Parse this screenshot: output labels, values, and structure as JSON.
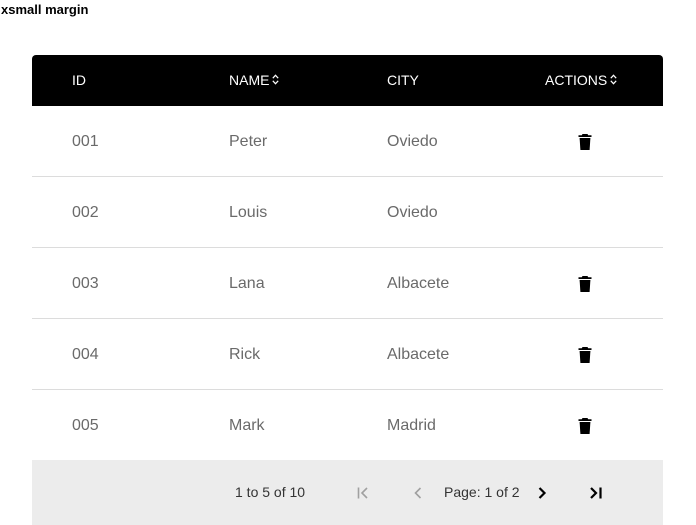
{
  "page": {
    "title": "xsmall margin"
  },
  "table": {
    "columns": [
      {
        "label": "ID",
        "sortable": false
      },
      {
        "label": "NAME",
        "sortable": true
      },
      {
        "label": "CITY",
        "sortable": false
      },
      {
        "label": "ACTIONS",
        "sortable": true
      }
    ],
    "rows": [
      {
        "id": "001",
        "name": "Peter",
        "city": "Oviedo",
        "has_delete": true
      },
      {
        "id": "002",
        "name": "Louis",
        "city": "Oviedo",
        "has_delete": false
      },
      {
        "id": "003",
        "name": "Lana",
        "city": "Albacete",
        "has_delete": true
      },
      {
        "id": "004",
        "name": "Rick",
        "city": "Albacete",
        "has_delete": true
      },
      {
        "id": "005",
        "name": "Mark",
        "city": "Madrid",
        "has_delete": true
      }
    ],
    "row_action_icon": "trash-icon"
  },
  "paginator": {
    "range_text": "1 to 5 of 10",
    "page_text": "Page: 1 of 2",
    "buttons": {
      "first": {
        "icon": "first-page-icon",
        "enabled": false
      },
      "prev": {
        "icon": "chevron-left-icon",
        "enabled": false
      },
      "next": {
        "icon": "chevron-right-icon",
        "enabled": true
      },
      "last": {
        "icon": "last-page-icon",
        "enabled": true
      }
    }
  },
  "colors": {
    "header_bg": "#000000",
    "header_text": "#ffffff",
    "cell_text": "#6a6a6a",
    "row_divider": "#dcdcdc",
    "paginator_bg": "#ececec",
    "disabled_icon": "#a0a0a0"
  }
}
